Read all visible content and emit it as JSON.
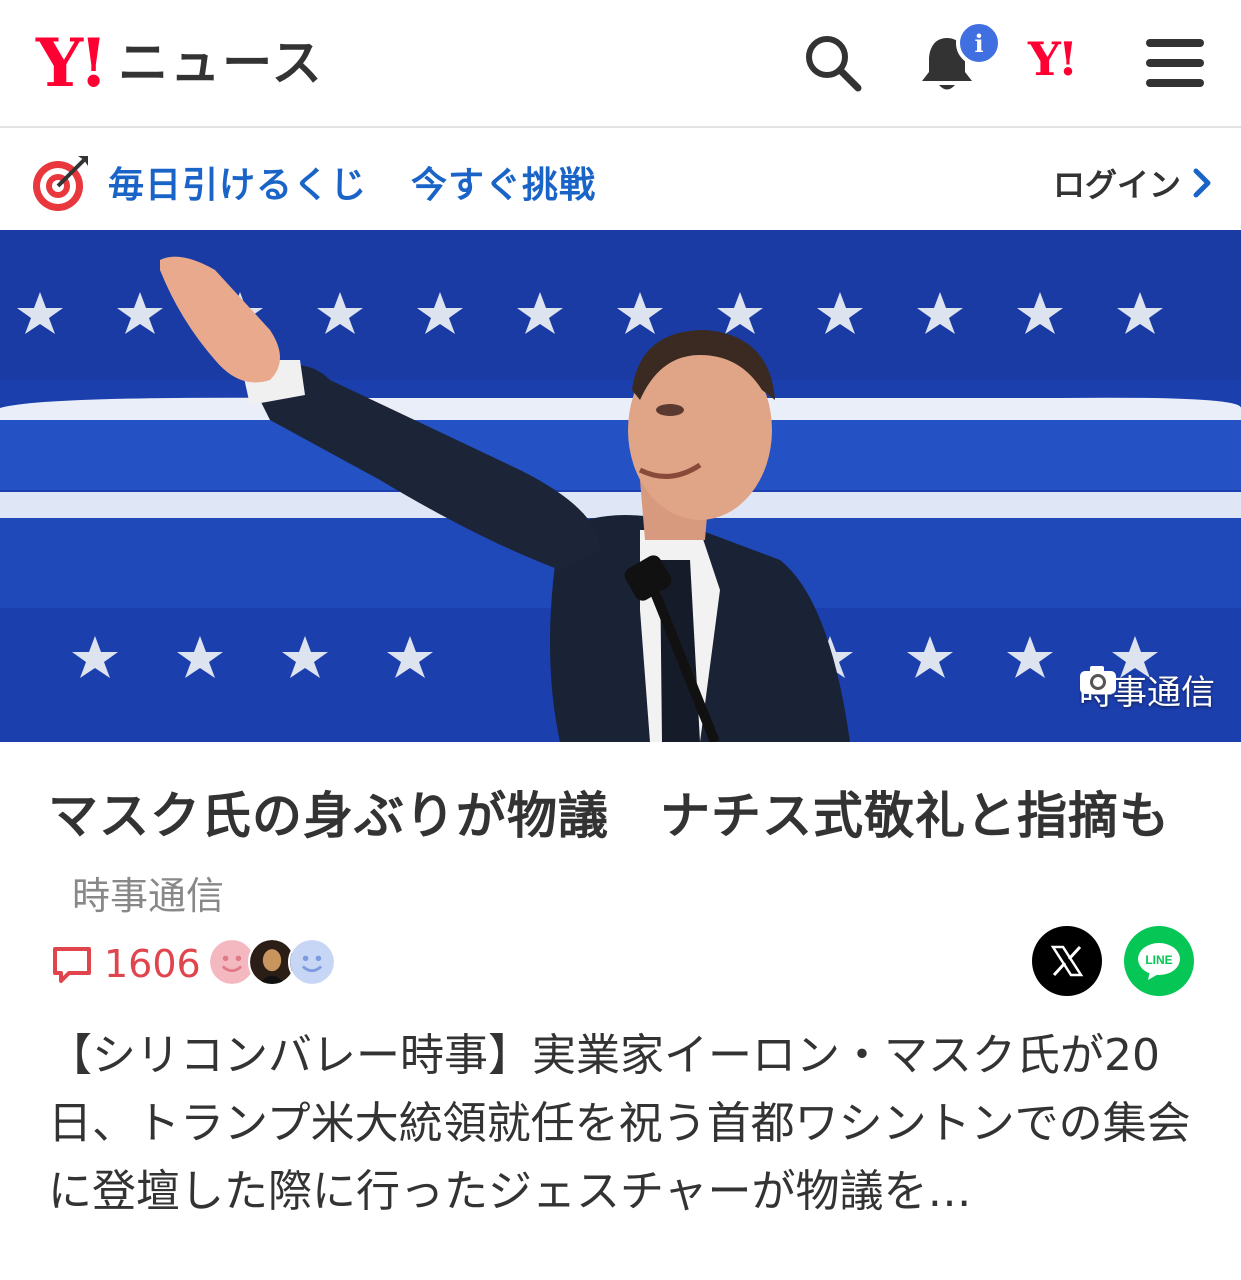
{
  "header": {
    "logo_mark": "Y!",
    "logo_text": "ニュース",
    "notification_badge": "i",
    "yahoo_mark": "Y!"
  },
  "promo": {
    "text_1": "毎日引けるくじ",
    "text_2": "今すぐ挑戦",
    "login_label": "ログイン"
  },
  "hero": {
    "photo_credit": "時事通信"
  },
  "article": {
    "title": "マスク氏の身ぶりが物議　ナチス式敬礼と指摘も",
    "source": "時事通信",
    "comment_count": "1606",
    "summary": "【シリコンバレー時事】実業家イーロン・マスク氏が20日、トランプ米大統領就任を祝う首都ワシントンでの集会に登壇した際に行ったジェスチャーが物議を…"
  },
  "share": {
    "line_label": "LINE"
  },
  "colors": {
    "brand_red": "#ff0033",
    "link_blue": "#1a64c8",
    "comment_red": "#e0454d",
    "badge_blue": "#3f6fe0",
    "line_green": "#06c755"
  },
  "icons": [
    "search-icon",
    "bell-icon",
    "menu-icon",
    "target-icon",
    "chevron-right-icon",
    "camera-icon",
    "comment-icon",
    "x-logo-icon",
    "line-logo-icon"
  ]
}
